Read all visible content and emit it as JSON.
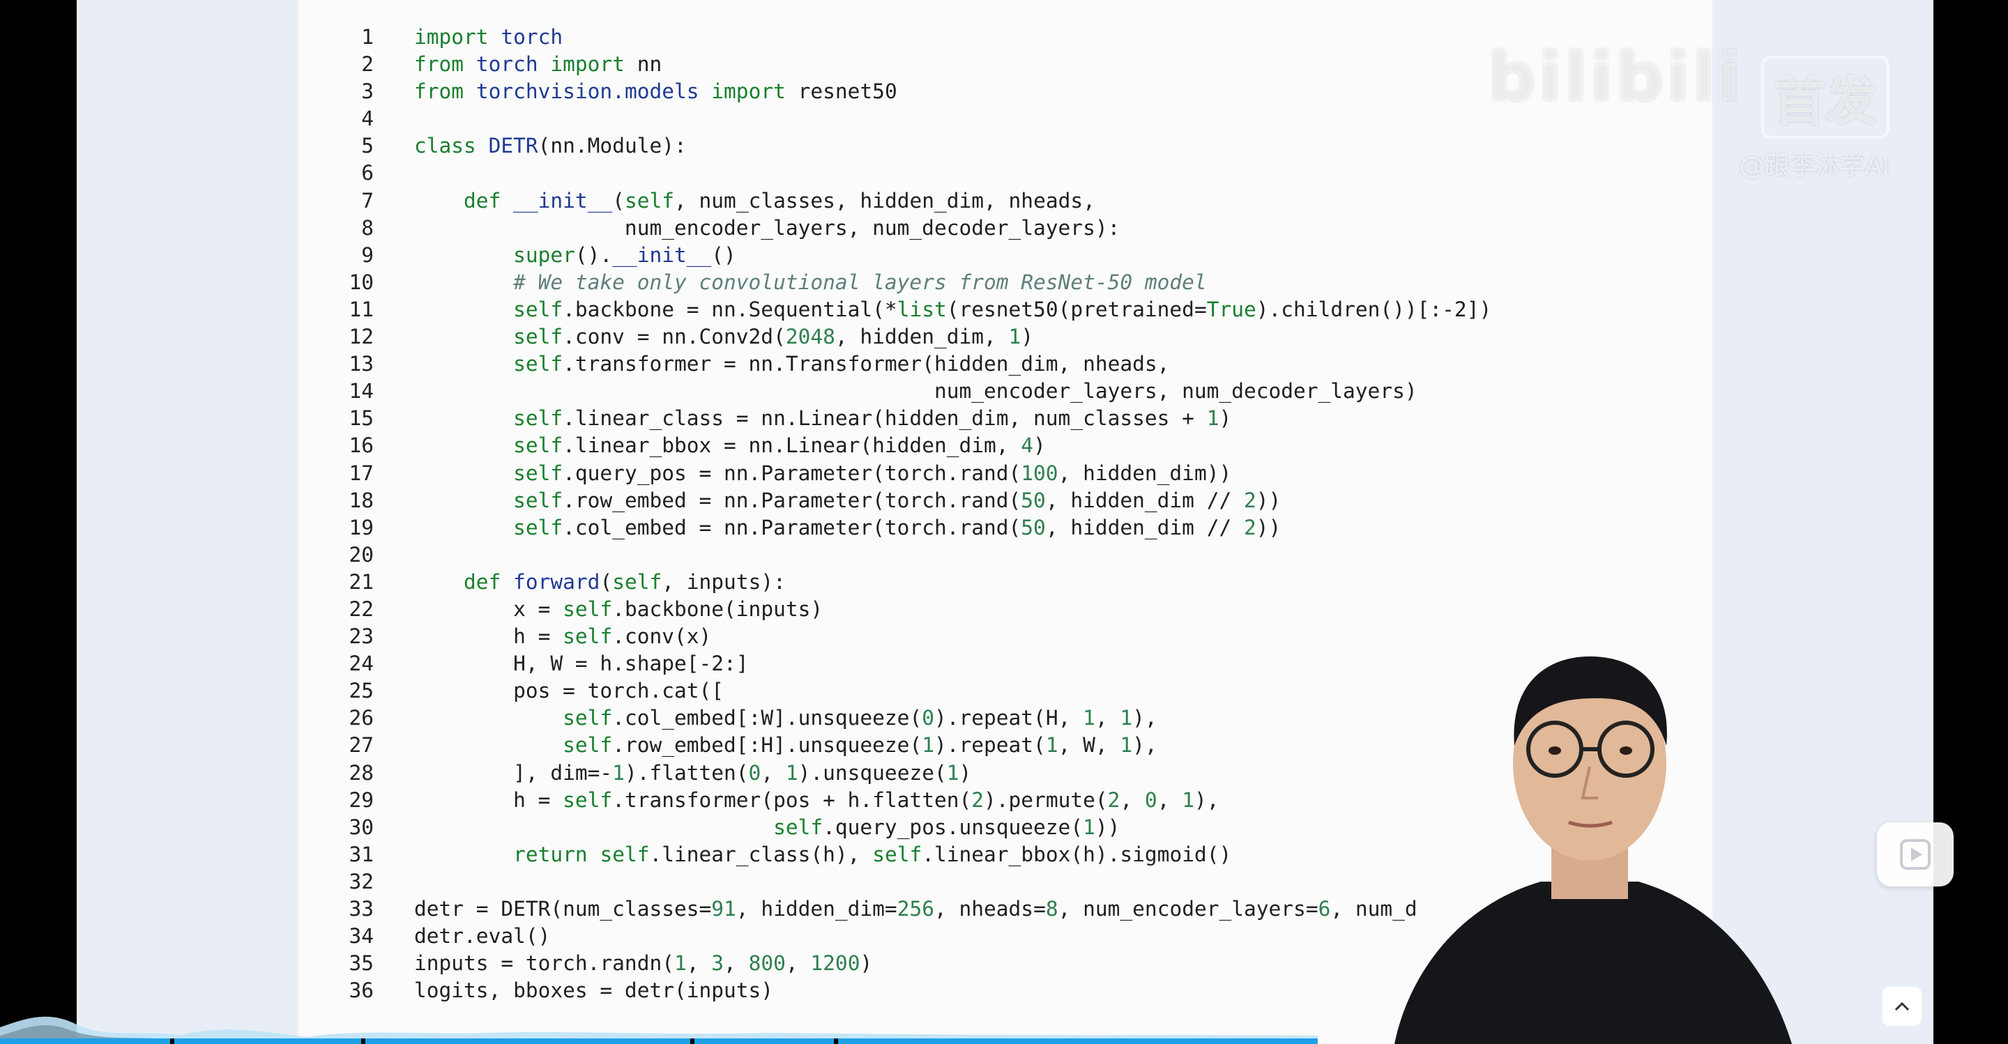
{
  "watermark": {
    "brand": "bilibili",
    "badge": "首发",
    "handle": "@跟李沐学AI"
  },
  "code": {
    "lines": [
      {
        "n": "1",
        "tokens": [
          {
            "t": "kw",
            "v": "import"
          },
          {
            "t": "txt",
            "v": " "
          },
          {
            "t": "fn",
            "v": "torch"
          }
        ]
      },
      {
        "n": "2",
        "tokens": [
          {
            "t": "kw",
            "v": "from"
          },
          {
            "t": "txt",
            "v": " "
          },
          {
            "t": "fn",
            "v": "torch"
          },
          {
            "t": "txt",
            "v": " "
          },
          {
            "t": "kw",
            "v": "import"
          },
          {
            "t": "txt",
            "v": " nn"
          }
        ]
      },
      {
        "n": "3",
        "tokens": [
          {
            "t": "kw",
            "v": "from"
          },
          {
            "t": "txt",
            "v": " "
          },
          {
            "t": "fn",
            "v": "torchvision.models"
          },
          {
            "t": "txt",
            "v": " "
          },
          {
            "t": "kw",
            "v": "import"
          },
          {
            "t": "txt",
            "v": " resnet50"
          }
        ]
      },
      {
        "n": "4",
        "tokens": []
      },
      {
        "n": "5",
        "tokens": [
          {
            "t": "kw",
            "v": "class"
          },
          {
            "t": "txt",
            "v": " "
          },
          {
            "t": "fn",
            "v": "DETR"
          },
          {
            "t": "txt",
            "v": "(nn.Module):"
          }
        ]
      },
      {
        "n": "6",
        "tokens": []
      },
      {
        "n": "7",
        "tokens": [
          {
            "t": "txt",
            "v": "    "
          },
          {
            "t": "kw",
            "v": "def"
          },
          {
            "t": "txt",
            "v": " "
          },
          {
            "t": "fn",
            "v": "__init__"
          },
          {
            "t": "txt",
            "v": "("
          },
          {
            "t": "bi",
            "v": "self"
          },
          {
            "t": "txt",
            "v": ", num_classes, hidden_dim, nheads,"
          }
        ]
      },
      {
        "n": "8",
        "tokens": [
          {
            "t": "txt",
            "v": "                 num_encoder_layers, num_decoder_layers):"
          }
        ]
      },
      {
        "n": "9",
        "tokens": [
          {
            "t": "txt",
            "v": "        "
          },
          {
            "t": "bi",
            "v": "super"
          },
          {
            "t": "txt",
            "v": "()."
          },
          {
            "t": "fn",
            "v": "__init__"
          },
          {
            "t": "txt",
            "v": "()"
          }
        ]
      },
      {
        "n": "10",
        "tokens": [
          {
            "t": "txt",
            "v": "        "
          },
          {
            "t": "cm",
            "v": "# We take only convolutional layers from ResNet-50 model"
          }
        ]
      },
      {
        "n": "11",
        "tokens": [
          {
            "t": "txt",
            "v": "        "
          },
          {
            "t": "bi",
            "v": "self"
          },
          {
            "t": "txt",
            "v": ".backbone = nn.Sequential(*"
          },
          {
            "t": "bi",
            "v": "list"
          },
          {
            "t": "txt",
            "v": "(resnet50(pretrained="
          },
          {
            "t": "bi",
            "v": "True"
          },
          {
            "t": "txt",
            "v": ").children())[:-2])"
          }
        ]
      },
      {
        "n": "12",
        "tokens": [
          {
            "t": "txt",
            "v": "        "
          },
          {
            "t": "bi",
            "v": "self"
          },
          {
            "t": "txt",
            "v": ".conv = nn.Conv2d("
          },
          {
            "t": "num",
            "v": "2048"
          },
          {
            "t": "txt",
            "v": ", hidden_dim, "
          },
          {
            "t": "num",
            "v": "1"
          },
          {
            "t": "txt",
            "v": ")"
          }
        ]
      },
      {
        "n": "13",
        "tokens": [
          {
            "t": "txt",
            "v": "        "
          },
          {
            "t": "bi",
            "v": "self"
          },
          {
            "t": "txt",
            "v": ".transformer = nn.Transformer(hidden_dim, nheads,"
          }
        ]
      },
      {
        "n": "14",
        "tokens": [
          {
            "t": "txt",
            "v": "                                          num_encoder_layers, num_decoder_layers)"
          }
        ]
      },
      {
        "n": "15",
        "tokens": [
          {
            "t": "txt",
            "v": "        "
          },
          {
            "t": "bi",
            "v": "self"
          },
          {
            "t": "txt",
            "v": ".linear_class = nn.Linear(hidden_dim, num_classes + "
          },
          {
            "t": "num",
            "v": "1"
          },
          {
            "t": "txt",
            "v": ")"
          }
        ]
      },
      {
        "n": "16",
        "tokens": [
          {
            "t": "txt",
            "v": "        "
          },
          {
            "t": "bi",
            "v": "self"
          },
          {
            "t": "txt",
            "v": ".linear_bbox = nn.Linear(hidden_dim, "
          },
          {
            "t": "num",
            "v": "4"
          },
          {
            "t": "txt",
            "v": ")"
          }
        ]
      },
      {
        "n": "17",
        "tokens": [
          {
            "t": "txt",
            "v": "        "
          },
          {
            "t": "bi",
            "v": "self"
          },
          {
            "t": "txt",
            "v": ".query_pos = nn.Parameter(torch.rand("
          },
          {
            "t": "num",
            "v": "100"
          },
          {
            "t": "txt",
            "v": ", hidden_dim))"
          }
        ]
      },
      {
        "n": "18",
        "tokens": [
          {
            "t": "txt",
            "v": "        "
          },
          {
            "t": "bi",
            "v": "self"
          },
          {
            "t": "txt",
            "v": ".row_embed = nn.Parameter(torch.rand("
          },
          {
            "t": "num",
            "v": "50"
          },
          {
            "t": "txt",
            "v": ", hidden_dim // "
          },
          {
            "t": "num",
            "v": "2"
          },
          {
            "t": "txt",
            "v": "))"
          }
        ]
      },
      {
        "n": "19",
        "tokens": [
          {
            "t": "txt",
            "v": "        "
          },
          {
            "t": "bi",
            "v": "self"
          },
          {
            "t": "txt",
            "v": ".col_embed = nn.Parameter(torch.rand("
          },
          {
            "t": "num",
            "v": "50"
          },
          {
            "t": "txt",
            "v": ", hidden_dim // "
          },
          {
            "t": "num",
            "v": "2"
          },
          {
            "t": "txt",
            "v": "))"
          }
        ]
      },
      {
        "n": "20",
        "tokens": []
      },
      {
        "n": "21",
        "tokens": [
          {
            "t": "txt",
            "v": "    "
          },
          {
            "t": "kw",
            "v": "def"
          },
          {
            "t": "txt",
            "v": " "
          },
          {
            "t": "fn",
            "v": "forward"
          },
          {
            "t": "txt",
            "v": "("
          },
          {
            "t": "bi",
            "v": "self"
          },
          {
            "t": "txt",
            "v": ", inputs):"
          }
        ]
      },
      {
        "n": "22",
        "tokens": [
          {
            "t": "txt",
            "v": "        x = "
          },
          {
            "t": "bi",
            "v": "self"
          },
          {
            "t": "txt",
            "v": ".backbone(inputs)"
          }
        ]
      },
      {
        "n": "23",
        "tokens": [
          {
            "t": "txt",
            "v": "        h = "
          },
          {
            "t": "bi",
            "v": "self"
          },
          {
            "t": "txt",
            "v": ".conv(x)"
          }
        ]
      },
      {
        "n": "24",
        "tokens": [
          {
            "t": "txt",
            "v": "        H, W = h.shape[-2:]"
          }
        ]
      },
      {
        "n": "25",
        "tokens": [
          {
            "t": "txt",
            "v": "        pos = torch.cat(["
          }
        ]
      },
      {
        "n": "26",
        "tokens": [
          {
            "t": "txt",
            "v": "            "
          },
          {
            "t": "bi",
            "v": "self"
          },
          {
            "t": "txt",
            "v": ".col_embed[:W].unsqueeze("
          },
          {
            "t": "num",
            "v": "0"
          },
          {
            "t": "txt",
            "v": ").repeat(H, "
          },
          {
            "t": "num",
            "v": "1"
          },
          {
            "t": "txt",
            "v": ", "
          },
          {
            "t": "num",
            "v": "1"
          },
          {
            "t": "txt",
            "v": "),"
          }
        ]
      },
      {
        "n": "27",
        "tokens": [
          {
            "t": "txt",
            "v": "            "
          },
          {
            "t": "bi",
            "v": "self"
          },
          {
            "t": "txt",
            "v": ".row_embed[:H].unsqueeze("
          },
          {
            "t": "num",
            "v": "1"
          },
          {
            "t": "txt",
            "v": ").repeat("
          },
          {
            "t": "num",
            "v": "1"
          },
          {
            "t": "txt",
            "v": ", W, "
          },
          {
            "t": "num",
            "v": "1"
          },
          {
            "t": "txt",
            "v": "),"
          }
        ]
      },
      {
        "n": "28",
        "tokens": [
          {
            "t": "txt",
            "v": "        ], dim=-"
          },
          {
            "t": "num",
            "v": "1"
          },
          {
            "t": "txt",
            "v": ").flatten("
          },
          {
            "t": "num",
            "v": "0"
          },
          {
            "t": "txt",
            "v": ", "
          },
          {
            "t": "num",
            "v": "1"
          },
          {
            "t": "txt",
            "v": ").unsqueeze("
          },
          {
            "t": "num",
            "v": "1"
          },
          {
            "t": "txt",
            "v": ")"
          }
        ]
      },
      {
        "n": "29",
        "tokens": [
          {
            "t": "txt",
            "v": "        h = "
          },
          {
            "t": "bi",
            "v": "self"
          },
          {
            "t": "txt",
            "v": ".transformer(pos + h.flatten("
          },
          {
            "t": "num",
            "v": "2"
          },
          {
            "t": "txt",
            "v": ").permute("
          },
          {
            "t": "num",
            "v": "2"
          },
          {
            "t": "txt",
            "v": ", "
          },
          {
            "t": "num",
            "v": "0"
          },
          {
            "t": "txt",
            "v": ", "
          },
          {
            "t": "num",
            "v": "1"
          },
          {
            "t": "txt",
            "v": "),"
          }
        ]
      },
      {
        "n": "30",
        "tokens": [
          {
            "t": "txt",
            "v": "                             "
          },
          {
            "t": "bi",
            "v": "self"
          },
          {
            "t": "txt",
            "v": ".query_pos.unsqueeze("
          },
          {
            "t": "num",
            "v": "1"
          },
          {
            "t": "txt",
            "v": "))"
          }
        ]
      },
      {
        "n": "31",
        "tokens": [
          {
            "t": "txt",
            "v": "        "
          },
          {
            "t": "kw",
            "v": "return"
          },
          {
            "t": "txt",
            "v": " "
          },
          {
            "t": "bi",
            "v": "self"
          },
          {
            "t": "txt",
            "v": ".linear_class(h), "
          },
          {
            "t": "bi",
            "v": "self"
          },
          {
            "t": "txt",
            "v": ".linear_bbox(h).sigmoid()"
          }
        ]
      },
      {
        "n": "32",
        "tokens": []
      },
      {
        "n": "33",
        "tokens": [
          {
            "t": "txt",
            "v": "detr = DETR(num_classes="
          },
          {
            "t": "num",
            "v": "91"
          },
          {
            "t": "txt",
            "v": ", hidden_dim="
          },
          {
            "t": "num",
            "v": "256"
          },
          {
            "t": "txt",
            "v": ", nheads="
          },
          {
            "t": "num",
            "v": "8"
          },
          {
            "t": "txt",
            "v": ", num_encoder_layers="
          },
          {
            "t": "num",
            "v": "6"
          },
          {
            "t": "txt",
            "v": ", num_d"
          }
        ]
      },
      {
        "n": "34",
        "tokens": [
          {
            "t": "txt",
            "v": "detr.eval()"
          }
        ]
      },
      {
        "n": "35",
        "tokens": [
          {
            "t": "txt",
            "v": "inputs = torch.randn("
          },
          {
            "t": "num",
            "v": "1"
          },
          {
            "t": "txt",
            "v": ", "
          },
          {
            "t": "num",
            "v": "3"
          },
          {
            "t": "txt",
            "v": ", "
          },
          {
            "t": "num",
            "v": "800"
          },
          {
            "t": "txt",
            "v": ", "
          },
          {
            "t": "num",
            "v": "1200"
          },
          {
            "t": "txt",
            "v": ")"
          }
        ]
      },
      {
        "n": "36",
        "tokens": [
          {
            "t": "txt",
            "v": "logits, bboxes = detr(inputs)"
          }
        ]
      }
    ]
  },
  "player": {
    "progress_fraction": 1.0,
    "icons": {
      "play": "play-icon",
      "scroll_top": "chevron-up-icon"
    }
  }
}
